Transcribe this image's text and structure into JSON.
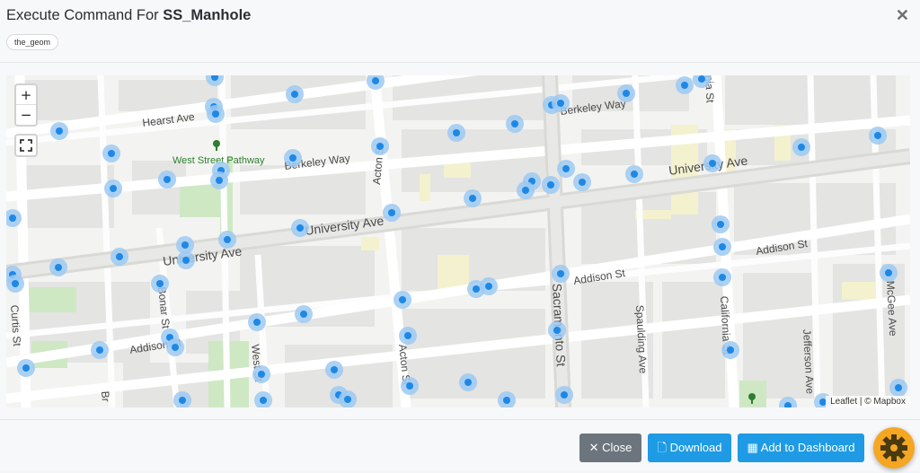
{
  "modal": {
    "title_prefix": "Execute Command For ",
    "title_layer": "SS_Manhole",
    "close_icon": "close-icon",
    "chip": "the_geom"
  },
  "map": {
    "zoom_in": "+",
    "zoom_out": "−",
    "attribution": "Leaflet | © Mapbox",
    "street_labels": {
      "hearst": "Hearst Ave",
      "berkeley_way_w": "Berkeley Way",
      "berkeley_way_e": "Berkeley Way",
      "university_w": "University Ave",
      "university_m": "University Ave",
      "university_e": "University Ave",
      "addison_w": "Addison St",
      "addison_m": "Addison St",
      "addison_e": "Addison St",
      "acton_n": "Acton St",
      "acton_s": "Acton St",
      "bonar": "Bonar St",
      "curtis": "Curtis St",
      "west": "West St",
      "br": "Br",
      "sacramento": "Sacramento St",
      "spaulding": "Spaulding Ave",
      "california": "California St",
      "jefferson": "Jefferson Ave",
      "mcgee": "McGee Ave",
      "nia": "nia St",
      "park": "West Street Pathway"
    },
    "colors": {
      "marker": "#1e88e5",
      "marker_halo": "#9cc9f2",
      "park": "#cfe8c4",
      "land": "#f3f3f1"
    }
  },
  "footer": {
    "close_label": "Close",
    "download_label": "Download",
    "dashboard_label": "Add to Dashboard",
    "close_icon": "x-icon",
    "download_icon": "file-icon",
    "dashboard_icon": "table-icon",
    "gear_icon": "gear-icon"
  }
}
